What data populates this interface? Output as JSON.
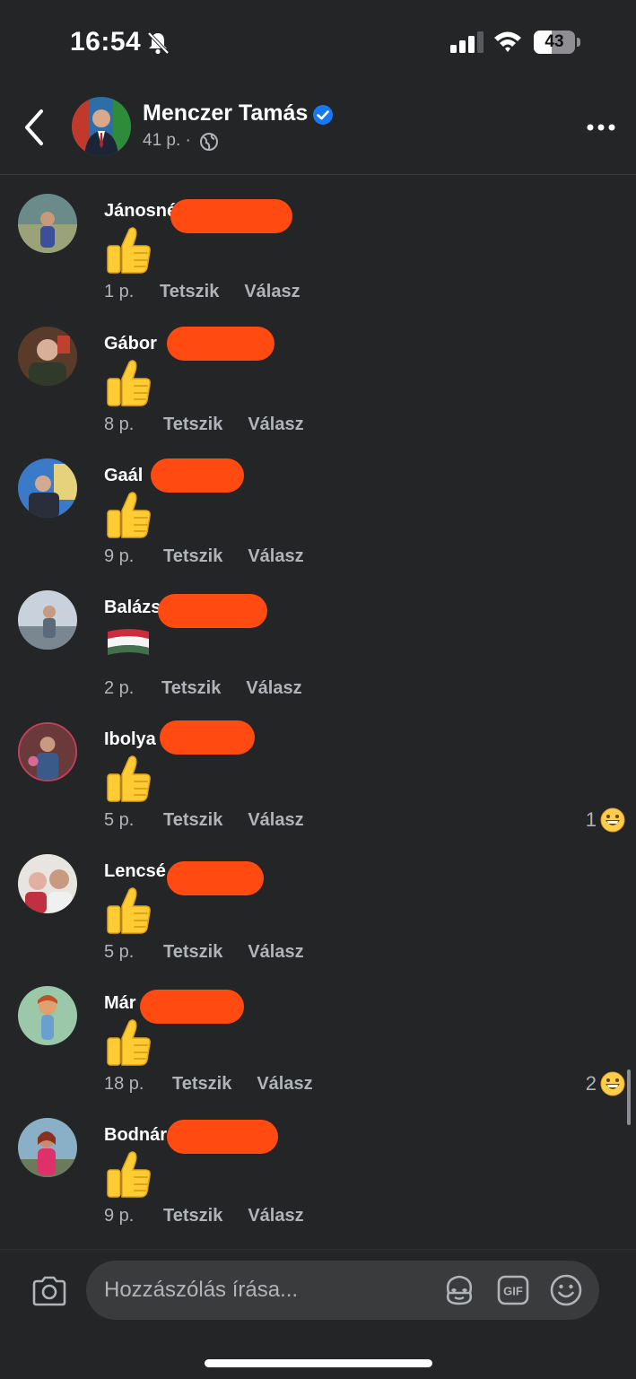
{
  "status_bar": {
    "time": "16:54",
    "battery": "43",
    "battery_percent": 43
  },
  "header": {
    "name": "Menczer Tamás",
    "meta": "41 p. ·",
    "icons": [
      "back-chevron-icon",
      "verified-badge-icon",
      "globe-icon",
      "more-options-icon"
    ]
  },
  "comments": [
    {
      "name": "Jánosné",
      "time": "1 p.",
      "like": "Tetszik",
      "reply": "Válasz",
      "content": "thumbs-up-emoji"
    },
    {
      "name": "Gábor",
      "time": "8 p.",
      "like": "Tetszik",
      "reply": "Válasz",
      "content": "thumbs-up-emoji"
    },
    {
      "name": "Gaál",
      "time": "9 p.",
      "like": "Tetszik",
      "reply": "Válasz",
      "content": "thumbs-up-emoji"
    },
    {
      "name": "Balázs",
      "time": "2 p.",
      "like": "Tetszik",
      "reply": "Válasz",
      "content": "hungarian-flag-emoji"
    },
    {
      "name": "Ibolya",
      "time": "5 p.",
      "like": "Tetszik",
      "reply": "Válasz",
      "content": "thumbs-up-emoji",
      "reaction_count": "1"
    },
    {
      "name": "Lencsé",
      "time": "5 p.",
      "like": "Tetszik",
      "reply": "Válasz",
      "content": "thumbs-up-emoji"
    },
    {
      "name": "Már",
      "time": "18 p.",
      "like": "Tetszik",
      "reply": "Válasz",
      "content": "thumbs-up-emoji",
      "reaction_count": "2"
    },
    {
      "name": "Bodnár",
      "time": "9 p.",
      "like": "Tetszik",
      "reply": "Válasz",
      "content": "thumbs-up-emoji"
    }
  ],
  "composer": {
    "placeholder": "Hozzászólás írása...",
    "icons": [
      "camera-icon",
      "avatar-sticker-icon",
      "gif-icon",
      "emoji-icon"
    ]
  },
  "colors": {
    "background": "#242526",
    "input_background": "#3a3b3c",
    "secondary_text": "#b0b3b8",
    "verified_blue": "#1877f2",
    "redaction": "#ff4b12"
  }
}
